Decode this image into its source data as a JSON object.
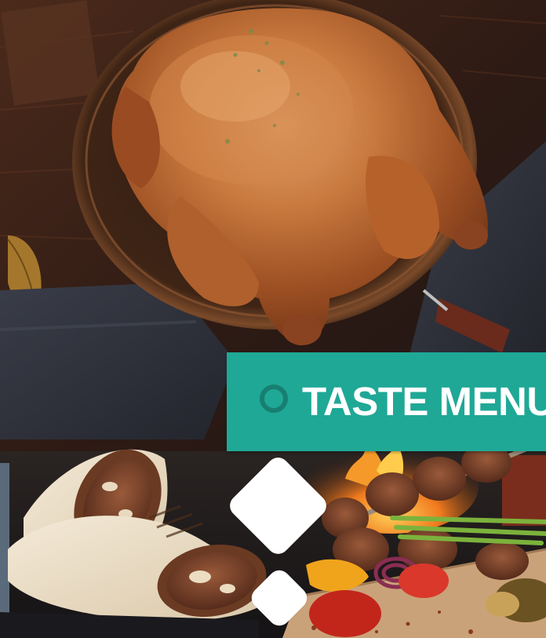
{
  "banner": {
    "title": "TASTE MENU",
    "background_color": "#1fa896",
    "text_color": "#ffffff",
    "ring_color": "#177f71"
  },
  "photos": {
    "top": "roast-chicken-photo",
    "bottom_left": "shawarma-wrap-photo",
    "bottom_right": "grilled-kebab-photo"
  },
  "ornaments": {
    "diamond_color": "#ffffff",
    "shape": "rounded-diamond"
  }
}
